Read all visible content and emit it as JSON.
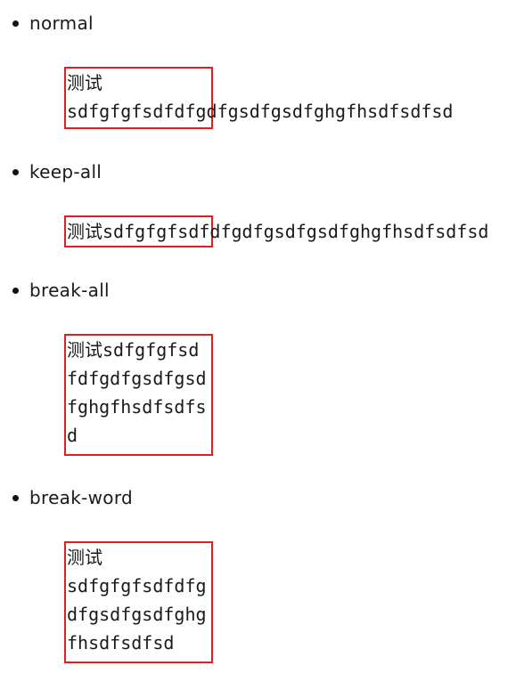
{
  "sections": [
    {
      "label": "normal",
      "lines": [
        "测试",
        "sdfgfgfsdfdfgdfgsdfgsdfghgfhsdfsdfsd"
      ]
    },
    {
      "label": "keep-all",
      "lines": [
        "测试sdfgfgfsdfdfgdfgsdfgsdfghgfhsdfsdfsd"
      ]
    },
    {
      "label": "break-all",
      "lines": [
        "测试sdfgfgfsd",
        "fdfgdfgsdfgsd",
        "fghgfhsdfsdfs",
        "d"
      ]
    },
    {
      "label": "break-word",
      "lines": [
        "测试",
        "sdfgfgfsdfdfg",
        "dfgsdfgsdfghg",
        "fhsdfsdfsd"
      ]
    }
  ],
  "colors": {
    "box_border": "#e02020",
    "text": "#1a1a1a",
    "background": "#ffffff"
  }
}
